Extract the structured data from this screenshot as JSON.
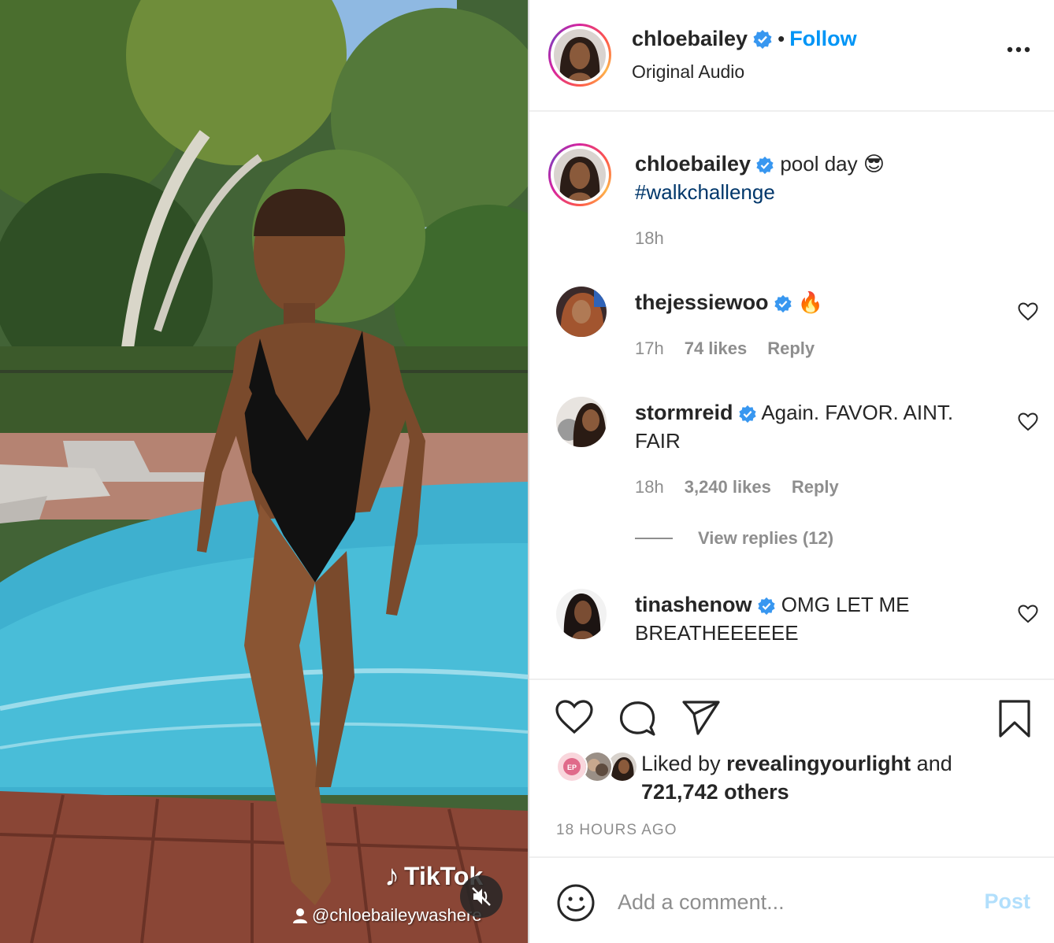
{
  "media": {
    "watermark": {
      "brand": "TikTok",
      "handle": "@chloebaileywashere"
    },
    "mute_icon": "speaker-muted-icon"
  },
  "header": {
    "username": "chloebailey",
    "follow_separator": "•",
    "follow_label": "Follow",
    "audio": "Original Audio",
    "more_icon": "more-horizontal-icon"
  },
  "caption": {
    "username": "chloebailey",
    "text": "pool day 😎",
    "hashtag": "#walkchallenge",
    "time": "18h"
  },
  "comments": [
    {
      "username": "thejessiewoo",
      "text": "🔥",
      "time": "17h",
      "likes": "74 likes",
      "reply": "Reply"
    },
    {
      "username": "stormreid",
      "text": "Again. FAVOR. AINT. FAIR",
      "time": "18h",
      "likes": "3,240 likes",
      "reply": "Reply",
      "view_replies": "View replies (12)"
    },
    {
      "username": "tinashenow",
      "text": "OMG LET ME BREATHEEEEEE"
    }
  ],
  "actions": {
    "icons": [
      "heart-icon",
      "comment-icon",
      "share-icon",
      "bookmark-icon"
    ]
  },
  "likes": {
    "prefix": "Liked by",
    "user": "revealingyourlight",
    "connector": "and",
    "others": "721,742 others"
  },
  "timestamp": "18 HOURS AGO",
  "comment_box": {
    "placeholder": "Add a comment...",
    "post_label": "Post"
  },
  "colors": {
    "accent": "#0095f6",
    "verified": "#3897f0",
    "hashtag": "#00376b",
    "muted_text": "#8e8e8e",
    "post_disabled": "#b2dffc"
  }
}
